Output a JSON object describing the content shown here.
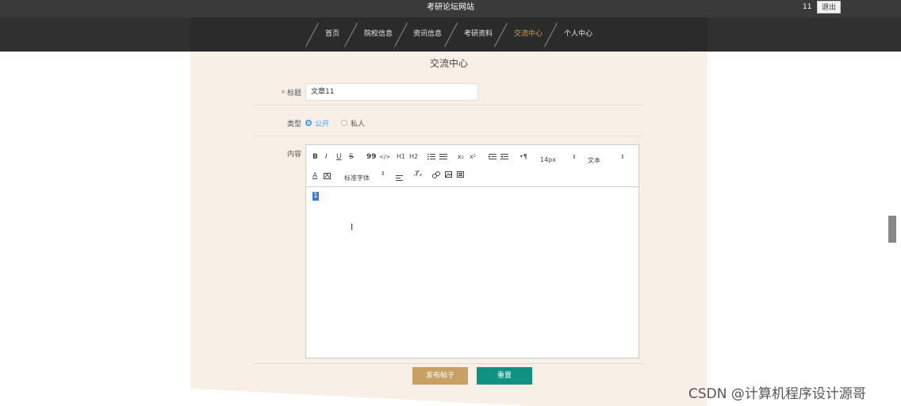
{
  "header": {
    "site_title": "考研论坛网站",
    "user": "11",
    "logout_label": "退出"
  },
  "nav": {
    "items": [
      {
        "label": "首页"
      },
      {
        "label": "院校信息"
      },
      {
        "label": "资讯信息"
      },
      {
        "label": "考研资料"
      },
      {
        "label": "交流中心"
      },
      {
        "label": "个人中心"
      }
    ],
    "active_index": 4,
    "active_color": "#c9a26b"
  },
  "page": {
    "heading": "交流中心"
  },
  "form": {
    "title_label": "标题",
    "title_required_mark": "*",
    "title_value": "文章11",
    "type_label": "类型",
    "type_options": [
      {
        "label": "公开",
        "selected": true
      },
      {
        "label": "私人",
        "selected": false
      }
    ],
    "content_label": "内容"
  },
  "editor": {
    "toolbar": {
      "bold": "B",
      "italic": "I",
      "underline": "U",
      "strike": "S",
      "quote": "99",
      "code": "</>",
      "h1": "H1",
      "h2": "H2",
      "ordered_list_icon": "ordered-list-icon",
      "bullet_list_icon": "bullet-list-icon",
      "subscript": "x₂",
      "superscript": "x²",
      "font_size": "14px",
      "header_select": "文本",
      "font_family": "标准字体"
    },
    "body_text": "1"
  },
  "buttons": {
    "publish": "发布帖子",
    "reset": "重置"
  },
  "colors": {
    "panel_bg": "#f8efe6",
    "publish_btn": "#c8a064",
    "reset_btn": "#0f9281",
    "selected_radio": "#409eff"
  },
  "watermark": "CSDN @计算机程序设计源哥"
}
